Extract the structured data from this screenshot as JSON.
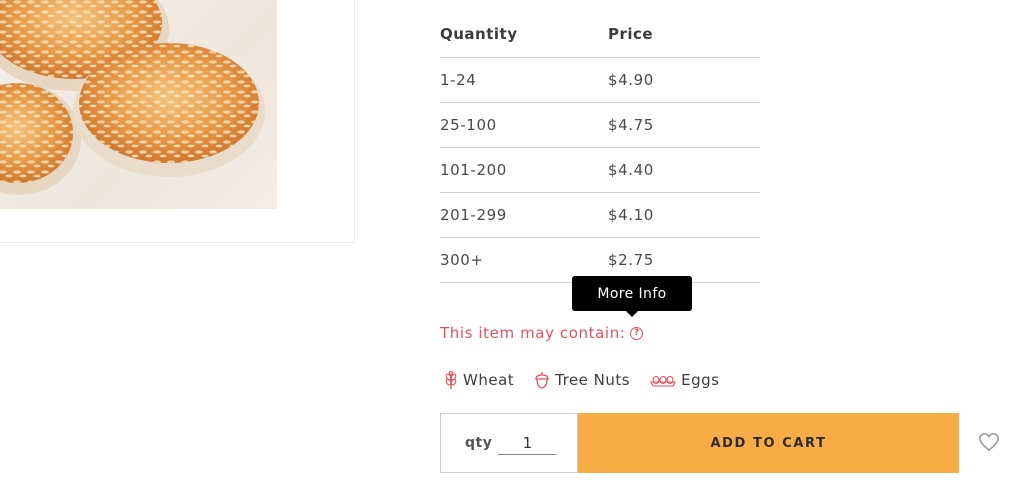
{
  "pricing": {
    "headers": [
      "Quantity",
      "Price"
    ],
    "rows": [
      {
        "qty": "1-24",
        "price": "$4.90"
      },
      {
        "qty": "25-100",
        "price": "$4.75"
      },
      {
        "qty": "101-200",
        "price": "$4.40"
      },
      {
        "qty": "201-299",
        "price": "$4.10"
      },
      {
        "qty": "300+",
        "price": "$2.75"
      }
    ]
  },
  "tooltip": {
    "text": "More Info"
  },
  "allergy": {
    "label": "This item may contain:",
    "help_icon": "question-circle-icon",
    "items": [
      {
        "label": "Wheat",
        "icon": "wheat-icon"
      },
      {
        "label": "Tree Nuts",
        "icon": "acorn-icon"
      },
      {
        "label": "Eggs",
        "icon": "eggs-icon"
      }
    ]
  },
  "cart": {
    "qty_label": "qty",
    "qty_value": "1",
    "add_button": "ADD TO CART",
    "wishlist_icon": "heart-icon"
  },
  "colors": {
    "accent": "#f8ac45",
    "warning_text": "#e2525f"
  }
}
